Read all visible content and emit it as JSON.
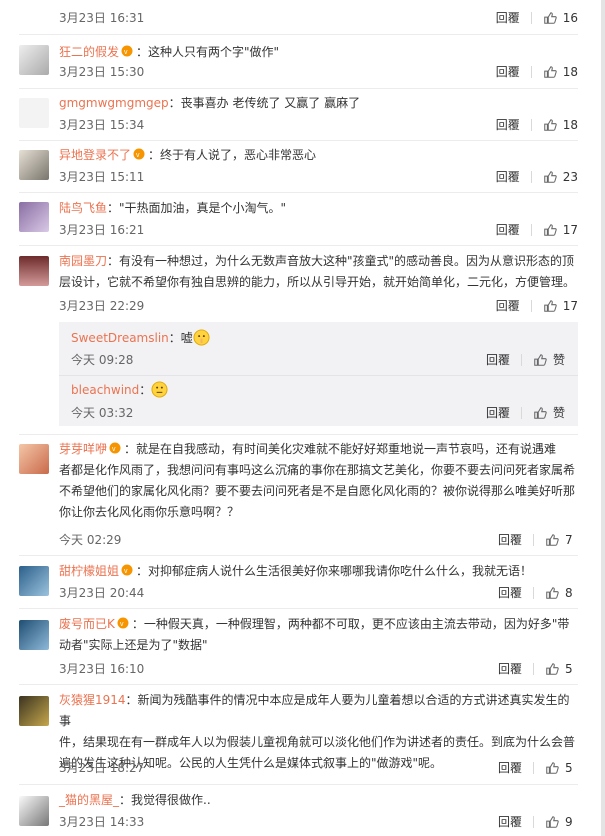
{
  "ui": {
    "reply_label": "回覆",
    "like_icon": "thumbs-up-icon",
    "vip_icon": "vip-badge-icon"
  },
  "top": {
    "date": "3月23日 16:31",
    "likes": "16"
  },
  "comments": [
    {
      "user": "狂二的假发",
      "text": "：这种人只有两个字\"做作\"",
      "date": "3月23日 15:30",
      "likes": "18"
    },
    {
      "user": "gmgmwgmgmgep",
      "text": "：丧事喜办 老传统了 又赢了 赢麻了",
      "date": "3月23日 15:34",
      "likes": "18"
    },
    {
      "user": "异地登录不了",
      "text": "：终于有人说了，恶心非常恶心",
      "date": "3月23日 15:11",
      "likes": "23"
    },
    {
      "user": "陆鸟飞鱼",
      "text": "：\"干热面加油，真是个小淘气。\"",
      "date": "3月23日 16:21",
      "likes": "17"
    },
    {
      "user": "南园墨刀",
      "text_lines": [
        "：有没有一种想过，为什么无数声音放大这种\"孩童式\"的感动善良。因为从意识形态的顶",
        "层设计，它就不希望你有独自思辨的能力，所以从引导开始，就开始简单化，二元化，方便管理。"
      ],
      "date": "3月23日 22:29",
      "likes": "17",
      "replies": [
        {
          "user": "SweetDreamslin",
          "text": "：嘘",
          "date": "今天 09:28",
          "likes": "赞"
        },
        {
          "user": "bleachwind",
          "text": "：",
          "date": "今天 03:32",
          "likes": "赞"
        }
      ]
    },
    {
      "user": "芽芽咩咿",
      "text_lines": [
        "：就是在自我感动，有时间美化灾难就不能好好郑重地说一声节哀吗，还有说遇难",
        "者都是化作风雨了，我想问问有事吗这么沉痛的事你在那搞文艺美化，你要不要去问问死者家属希",
        "不希望他们的家属化风化雨？要不要去问问死者是不是自愿化风化雨的？被你说得那么唯美好听那",
        "你让你去化风化雨你乐意吗啊？？"
      ],
      "date": "今天 02:29",
      "likes": "7"
    },
    {
      "user": "甜柠檬姐姐",
      "text": "：对抑郁症病人说什么生活很美好你来哪哪我请你吃什么什么，我就无语！",
      "date": "3月23日 20:44",
      "likes": "8"
    },
    {
      "user": "废号而已K",
      "text_lines": [
        "：一种假天真，一种假理智，两种都不可取，更不应该由主流去带动，因为好多\"带",
        "动者\"实际上还是为了\"数据\""
      ],
      "date": "3月23日 16:10",
      "likes": "5"
    },
    {
      "user": "灰猿猩1914",
      "text_lines": [
        "：新闻为残酷事件的情况中本应是成年人要为儿童着想以合适的方式讲述真实发生的事",
        "件，结果现在有一群成年人以为假装儿童视角就可以淡化他们作为讲述者的责任。到底为什么会普",
        "遍的发生这种认知呢。公民的人生凭什么是媒体式叙事上的\"做游戏\"呢。"
      ],
      "date": "3月23日 18:27",
      "likes": "5"
    },
    {
      "user": "_猫的黑屋_",
      "text": "：我觉得很做作..",
      "date": "3月23日 14:33",
      "likes": "9"
    }
  ]
}
